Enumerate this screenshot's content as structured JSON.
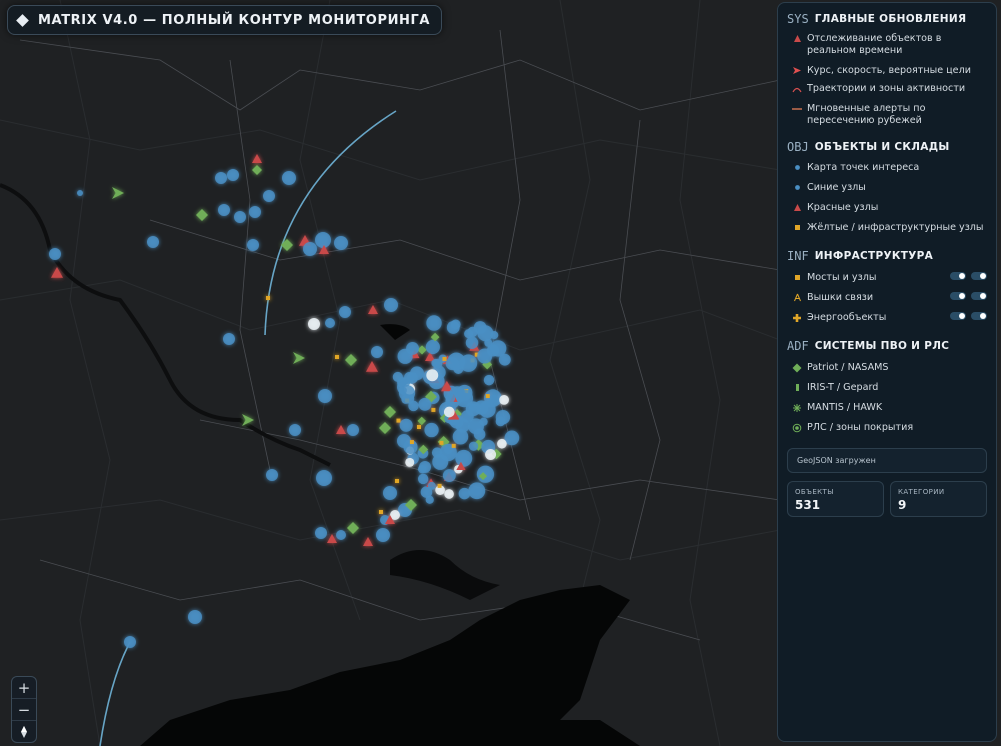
{
  "app": {
    "title": "MATRIX V4.0 — ПОЛНЫЙ КОНТУР МОНИТОРИНГА"
  },
  "zoom": {
    "in_label": "+",
    "out_label": "−",
    "reset_icon": "compass-icon"
  },
  "sections": [
    {
      "code": "SYS",
      "title": "ГЛАВНЫЕ ОБНОВЛЕНИЯ",
      "items": [
        {
          "label": "Отслеживание объектов в реальном времени",
          "icon": "red-triangle-icon"
        },
        {
          "label": "Курс, скорость, вероятные цели",
          "icon": "red-arrow-icon"
        },
        {
          "label": "Траектории и зоны активности",
          "icon": "arc-icon"
        },
        {
          "label": "Мгновенные алерты по пересечению рубежей",
          "icon": "line-icon"
        }
      ]
    },
    {
      "code": "OBJ",
      "title": "ОБЪЕКТЫ И СКЛАДЫ",
      "items": [
        {
          "label": "Карта точек интереса",
          "icon": "blue-dot-icon"
        },
        {
          "label": "Синие узлы",
          "icon": "blue-dot-icon"
        },
        {
          "label": "Красные узлы",
          "icon": "red-triangle-icon"
        },
        {
          "label": "Жёлтые / инфраструктурные узлы",
          "icon": "yellow-square-icon"
        }
      ]
    },
    {
      "code": "INF",
      "title": "ИНФРАСТРУКТУРА",
      "items": [
        {
          "label": "Мосты и узлы",
          "icon": "yellow-square-icon"
        },
        {
          "label": "Вышки связи",
          "icon": "tower-icon"
        },
        {
          "label": "Энергообъекты",
          "icon": "energy-plus-icon"
        }
      ]
    },
    {
      "code": "ADF",
      "title": "СИСТЕМЫ ПВО И РЛС",
      "items": [
        {
          "label": "Patriot / NASAMS",
          "icon": "green-diamond-icon"
        },
        {
          "label": "IRIS-T / Gepard",
          "icon": "green-bar-icon"
        },
        {
          "label": "MANTIS / HAWK",
          "icon": "green-star-icon"
        },
        {
          "label": "РЛС / зоны покрытия",
          "icon": "radar-ring-icon"
        }
      ]
    }
  ],
  "status": {
    "geojson": "GeoJSON загружен"
  },
  "stats": [
    {
      "label": "ОБЪЕКТЫ",
      "value": "531"
    },
    {
      "label": "КАТЕГОРИИ",
      "value": "9"
    }
  ],
  "colors": {
    "blue": "#4a8fc4",
    "red": "#c94a4a",
    "yellow": "#e0a628",
    "green": "#6fae58",
    "white": "#e8eef2",
    "track": "#6fb4d8"
  }
}
